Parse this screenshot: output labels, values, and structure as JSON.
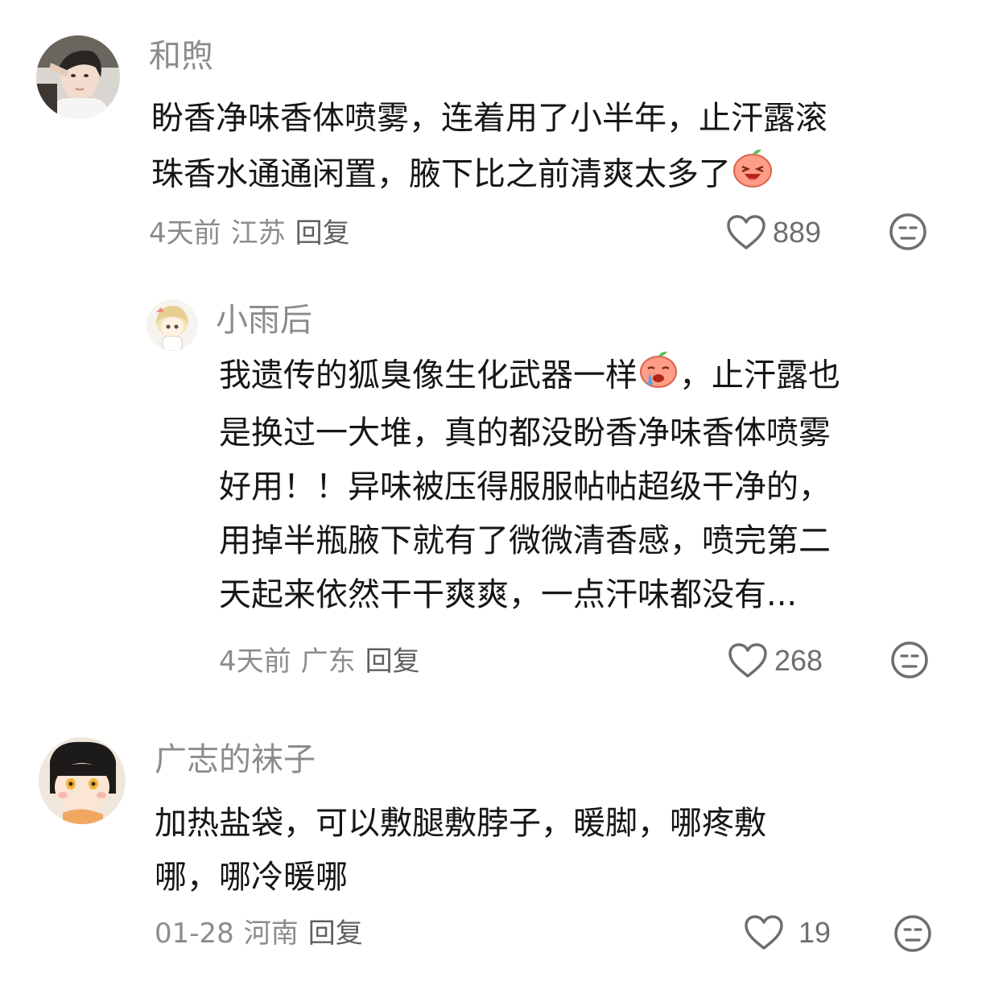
{
  "comments": [
    {
      "username": "和煦",
      "text_1": "盼香净味香体喷雾，连着用了小半年，止汗露滚",
      "text_2": "珠香水通通闲置，腋下比之前清爽太多了",
      "time": "4天前",
      "location": "江苏",
      "reply_label": "回复",
      "likes": "889",
      "avatar_icon": "user-photo-avatar",
      "inline_emoji": "laughing-peach-emoji"
    },
    {
      "username": "小雨后",
      "line_1a": "我遗传的狐臭像生化武器一样",
      "line_1b": "，止汗露也",
      "line_2": "是换过一大堆，真的都没盼香净味香体喷雾",
      "line_3": "好用！！异味被压得服服帖帖超级干净的，",
      "line_4": "用掉半瓶腋下就有了微微清香感，喷完第二",
      "line_5": "天起来依然干干爽爽，一点汗味都没有...",
      "time": "4天前",
      "location": "广东",
      "reply_label": "回复",
      "likes": "268",
      "avatar_icon": "anime-girl-avatar",
      "inline_emoji": "crying-peach-emoji"
    },
    {
      "username": "广志的袜子",
      "line_1": "加热盐袋，可以敷腿敷脖子，暖脚，哪疼敷",
      "line_2": "哪，哪冷暖哪",
      "time": "01-28",
      "location": "河南",
      "reply_label": "回复",
      "likes": "19",
      "avatar_icon": "cartoon-character-avatar"
    }
  ],
  "colors": {
    "text": "#161616",
    "muted": "#8c8c8c",
    "icon": "#6e6e6e"
  }
}
